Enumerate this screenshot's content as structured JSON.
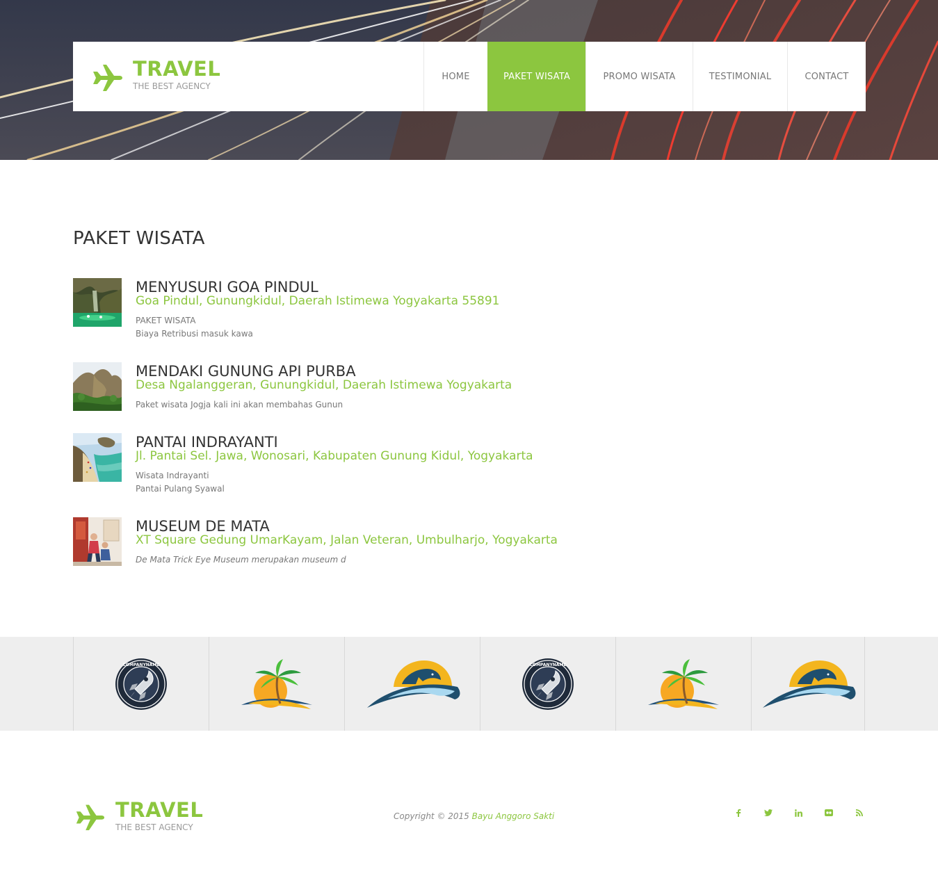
{
  "header": {
    "brand": "TRAVEL",
    "tagline": "THE BEST AGENCY",
    "nav": [
      {
        "label": "HOME"
      },
      {
        "label": "PAKET WISATA"
      },
      {
        "label": "PROMO WISATA"
      },
      {
        "label": "TESTIMONIAL"
      },
      {
        "label": "CONTACT"
      }
    ],
    "active_nav": "PAKET WISATA"
  },
  "main": {
    "title": "PAKET WISATA",
    "packages": [
      {
        "name": "MENYUSURI GOA PINDUL",
        "address": "Goa Pindul, Gunungkidul, Daerah Istimewa Yogyakarta 55891",
        "desc_lines": [
          "PAKET WISATA",
          "Biaya Retribusi masuk kawa"
        ]
      },
      {
        "name": "MENDAKI GUNUNG API PURBA",
        "address": "Desa Ngalanggeran, Gunungkidul, Daerah Istimewa Yogyakarta",
        "desc_lines": [
          "Paket wisata Jogja kali ini akan membahas Gunun"
        ]
      },
      {
        "name": "PANTAI INDRAYANTI",
        "address": "Jl. Pantai Sel. Jawa, Wonosari, Kabupaten Gunung Kidul, Yogyakarta",
        "desc_lines": [
          "Wisata Indrayanti",
          "Pantai Pulang Syawal"
        ]
      },
      {
        "name": "MUSEUM DE MATA",
        "address": "XT Square Gedung UmarKayam, Jalan Veteran, Umbulharjo, Yogyakarta",
        "desc_lines": [
          "De Mata Trick Eye Museum merupakan museum d"
        ]
      }
    ]
  },
  "clients": {
    "logos": [
      "rocket-badge-logo",
      "palm-island-logo",
      "dolphin-sun-logo",
      "rocket-badge-logo",
      "palm-island-logo",
      "dolphin-sun-logo"
    ],
    "badge_text": "COMPANYNAME"
  },
  "footer": {
    "brand": "TRAVEL",
    "tagline": "THE BEST AGENCY",
    "copyright": "Copyright © 2015",
    "author": "Bayu Anggoro Sakti",
    "social": [
      "facebook-icon",
      "twitter-icon",
      "linkedin-icon",
      "flickr-icon",
      "rss-icon"
    ]
  },
  "colors": {
    "accent": "#8cc63f",
    "text": "#333333",
    "muted": "#777777",
    "clients_bg": "#eeeeee"
  }
}
